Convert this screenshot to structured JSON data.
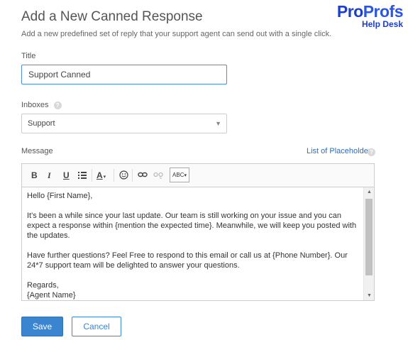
{
  "header": {
    "title": "Add a New Canned Response",
    "subtitle": "Add a new predefined set of reply that your support agent can send out with a single click."
  },
  "logo": {
    "brand_part1": "Pro",
    "brand_part2": "Profs",
    "product": "Help Desk",
    "color": "#1a3fc8"
  },
  "form": {
    "title_label": "Title",
    "title_value": "Support Canned",
    "inboxes_label": "Inboxes",
    "inboxes_selected": "Support",
    "message_label": "Message",
    "placeholders_link": "List of Placeholders",
    "help_glyph": "?"
  },
  "toolbar": {
    "bold": "B",
    "italic": "I",
    "underline": "U",
    "list_icon": "list-icon",
    "font_color": "A",
    "spellcheck": "ABC"
  },
  "message_body": {
    "greeting": "Hello {First Name},",
    "para1": "It's been a while since your last update. Our team is still working on your issue and you can expect a response within {mention the expected time}. Meanwhile, we will keep you posted with the updates.",
    "para2": "Have further questions? Feel Free to respond to this email or call us at {Phone Number}. Our 24*7 support team will be delighted to answer your questions.",
    "closing": "Regards,",
    "signature": "{Agent Name}"
  },
  "actions": {
    "save_label": "Save",
    "cancel_label": "Cancel",
    "accent_color": "#3a84d0"
  }
}
